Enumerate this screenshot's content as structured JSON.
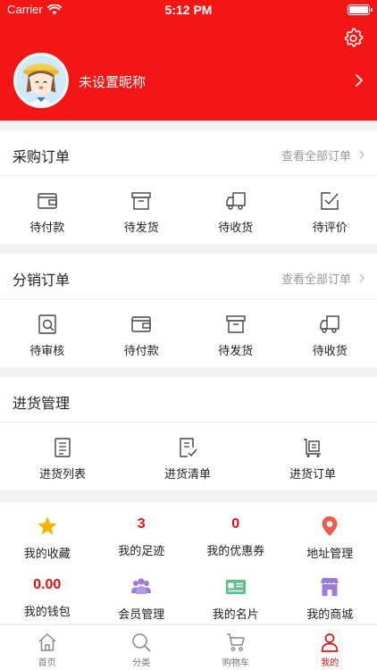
{
  "status_bar": {
    "carrier": "Carrier",
    "time": "5:12 PM"
  },
  "profile": {
    "nickname": "未设置昵称"
  },
  "purchase_orders": {
    "title": "采购订单",
    "view_all": "查看全部订单",
    "items": [
      {
        "label": "待付款",
        "icon": "wallet-icon"
      },
      {
        "label": "待发货",
        "icon": "box-icon"
      },
      {
        "label": "待收货",
        "icon": "truck-icon"
      },
      {
        "label": "待评价",
        "icon": "review-icon"
      }
    ]
  },
  "distribution_orders": {
    "title": "分销订单",
    "view_all": "查看全部订单",
    "items": [
      {
        "label": "待审核",
        "icon": "audit-icon"
      },
      {
        "label": "待付款",
        "icon": "wallet-icon"
      },
      {
        "label": "待发货",
        "icon": "box-icon"
      },
      {
        "label": "待收货",
        "icon": "truck-icon"
      }
    ]
  },
  "stock_management": {
    "title": "进货管理",
    "items": [
      {
        "label": "进货列表",
        "icon": "list-icon"
      },
      {
        "label": "进货清单",
        "icon": "checklist-icon"
      },
      {
        "label": "进货订单",
        "icon": "cart-order-icon"
      }
    ]
  },
  "quick_grid": {
    "row1": [
      {
        "label": "我的收藏",
        "icon": "star-icon"
      },
      {
        "label": "我的足迹",
        "value": "3"
      },
      {
        "label": "我的优惠券",
        "value": "0"
      },
      {
        "label": "地址管理",
        "icon": "location-icon"
      }
    ],
    "row2": [
      {
        "label": "我的钱包",
        "value": "0.00"
      },
      {
        "label": "会员管理",
        "icon": "members-icon"
      },
      {
        "label": "我的名片",
        "icon": "card-icon"
      },
      {
        "label": "我的商城",
        "icon": "shop-icon"
      }
    ]
  },
  "tabbar": [
    {
      "label": "首页",
      "icon": "home-icon"
    },
    {
      "label": "分类",
      "icon": "search-icon"
    },
    {
      "label": "购物车",
      "icon": "cart-icon"
    },
    {
      "label": "我的",
      "icon": "user-icon",
      "active": true
    }
  ],
  "colors": {
    "brand": "#f51515",
    "accent_text": "#e01010",
    "star": "#f5b400",
    "pin": "#f05a4a",
    "purple": "#9b7ad8",
    "green": "#58c08a"
  }
}
